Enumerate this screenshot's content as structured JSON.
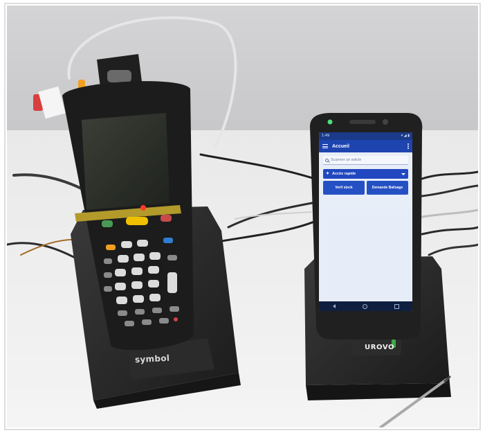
{
  "phone": {
    "status_time": "1:49",
    "status_icons": "▾ ◢ ▮",
    "app_title": "Accueil",
    "search_placeholder": "Scanner un article",
    "quick_actions_label": "Accès rapide",
    "buttons": [
      {
        "label": "Verif stock"
      },
      {
        "label": "Demande Balisage"
      }
    ]
  },
  "devices": {
    "left_brand": "symbol",
    "right_brand": "UROVO"
  },
  "colors": {
    "app_bar": "#1e44b0",
    "buttons": "#2550c4",
    "screen_background": "#e8eef8",
    "device_body": "#222222",
    "cradle": "#2a2a2a",
    "scan_key": "#f0c000"
  }
}
